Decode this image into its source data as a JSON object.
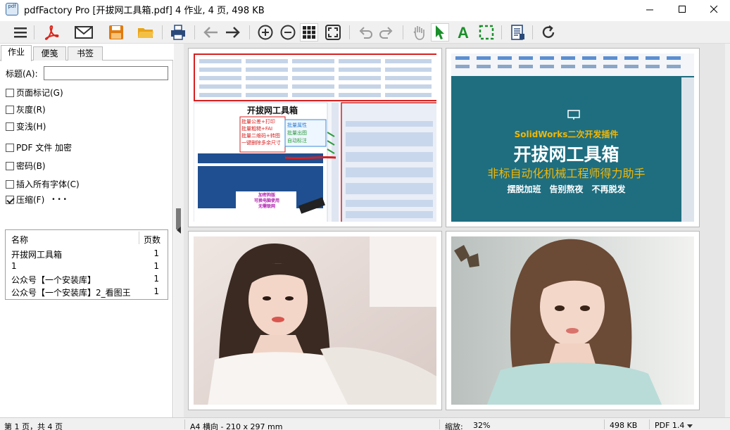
{
  "window": {
    "title": "pdfFactory Pro [开拔网工具箱.pdf] 4 作业, 4 页, 498 KB",
    "app_icon_text": "pdf"
  },
  "toolbar": {
    "buttons": [
      "menu-icon",
      "acrobat-icon",
      "email-icon",
      "save-icon",
      "open-folder-icon",
      "print-icon",
      "back-arrow-icon",
      "forward-arrow-icon",
      "zoom-in-icon",
      "zoom-out-icon",
      "grid-view-icon",
      "fit-page-icon",
      "undo-icon",
      "redo-icon",
      "hand-tool-icon",
      "select-arrow-icon",
      "text-tool-icon",
      "crop-select-icon",
      "page-properties-icon",
      "refresh-icon"
    ],
    "colors": {
      "acrobat": "#d9261c",
      "save": "#e07b10",
      "folder": "#e8a317",
      "select": "#1a8f2a",
      "text": "#1a8f2a"
    }
  },
  "tabs": [
    "作业",
    "便笺",
    "书签"
  ],
  "props": {
    "title_label": "标题(A):",
    "title_value": "",
    "options": [
      {
        "label": "页面标记(G)",
        "checked": false
      },
      {
        "label": "灰度(R)",
        "checked": false
      },
      {
        "label": "变浅(H)",
        "checked": false
      },
      {
        "label": "PDF 文件 加密",
        "checked": false
      },
      {
        "label": "密码(B)",
        "checked": false
      },
      {
        "label": "插入所有字体(C)",
        "checked": false
      },
      {
        "label": "压缩(F)",
        "checked": true
      }
    ],
    "more": "• • •"
  },
  "doc_list": {
    "headers": {
      "name": "名称",
      "pages": "页数"
    },
    "rows": [
      {
        "name": "开拔网工具箱",
        "pages": "1"
      },
      {
        "name": "1",
        "pages": "1"
      },
      {
        "name": "公众号【一个安装库】",
        "pages": "1"
      },
      {
        "name": "公众号【一个安装库】2_看图王",
        "pages": "1"
      }
    ]
  },
  "page2": {
    "title": "SolidWorks二次开发插件",
    "headline": "开拔网工具箱",
    "subtitle": "非标自动化机械工程师得力助手",
    "slogans": "摆脱加班　告别熬夜　不再脱发",
    "colors": {
      "bg": "#1e6e80",
      "headline": "#ffffff",
      "subtitle": "#f2b705",
      "title": "#f2b705"
    }
  },
  "page1": {
    "banner": "开拔网工具箱",
    "left_callouts": [
      "批量公差+打印",
      "批量粗糙+FAI",
      "批量二维码+转图",
      "一键删除多余尺寸"
    ],
    "right_callouts": [
      "批量属性",
      "批量出图",
      "自动标注"
    ],
    "dongle_text": "加密狗版\n可换电脑使用\n无需联网"
  },
  "status": {
    "page": "第 1 页，共 4 页",
    "paper": "A4 横向 - 210 x 297 mm",
    "zoom_label": "缩放:",
    "zoom_value": "32%",
    "size": "498 KB",
    "pdf_version": "PDF 1.4"
  }
}
